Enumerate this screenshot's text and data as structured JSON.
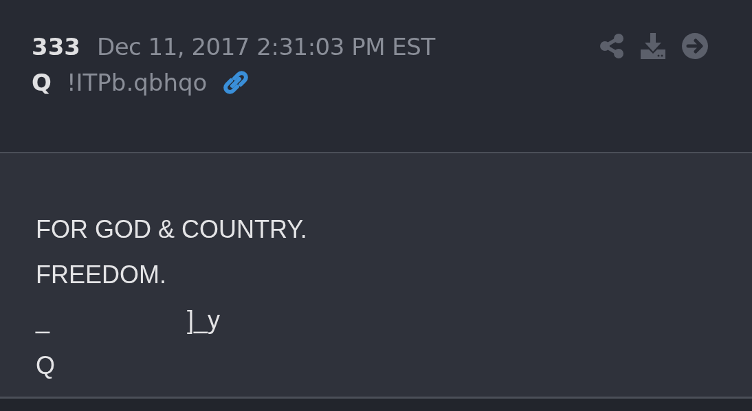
{
  "post": {
    "number": "333",
    "timestamp": "Dec 11, 2017 2:31:03 PM EST",
    "author": "Q",
    "tripcode": "!ITPb.qbhqo"
  },
  "body_lines": [
    [
      "FOR GOD & COUNTRY."
    ],
    [
      "FREEDOM."
    ],
    [
      "_",
      "]_y"
    ],
    [
      "Q"
    ]
  ]
}
